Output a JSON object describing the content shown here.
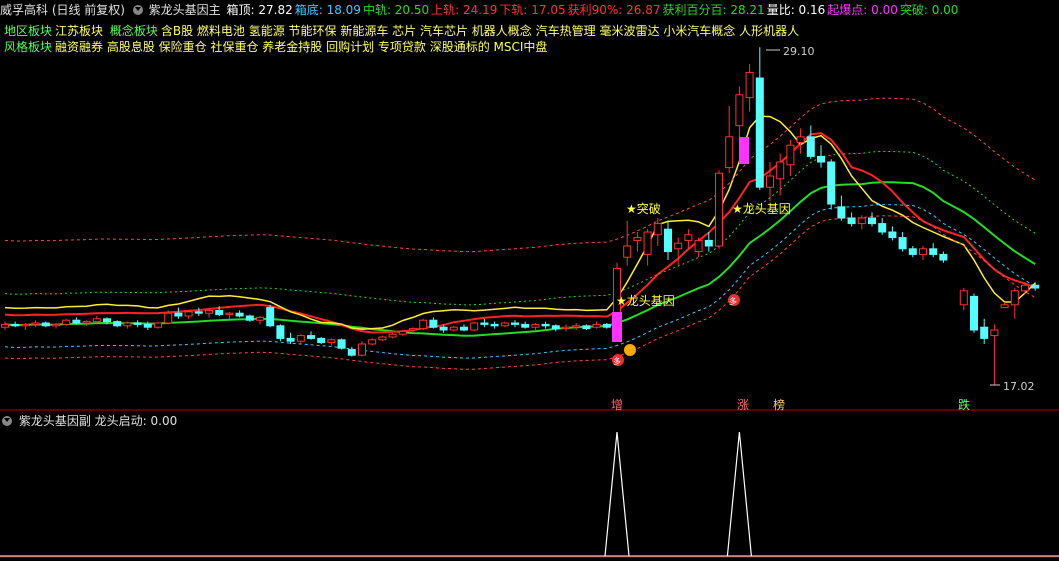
{
  "header": {
    "stock": "威孚高科 (日线 前复权)",
    "indicator": "紫龙头基因主",
    "items": [
      {
        "label": "箱顶:",
        "value": "27.82",
        "color": "#ffffff"
      },
      {
        "label": "箱底:",
        "value": "18.09",
        "color": "#3cc8ff"
      },
      {
        "label": "中轨:",
        "value": "20.50",
        "color": "#22dd22"
      },
      {
        "label": "上轨:",
        "value": "24.19",
        "color": "#ff3333"
      },
      {
        "label": "下轨:",
        "value": "17.05",
        "color": "#ff3333"
      },
      {
        "label": "获利90%:",
        "value": "26.87",
        "color": "#ff3333"
      },
      {
        "label": "获利百分百:",
        "value": "28.21",
        "color": "#22dd22"
      },
      {
        "label": "量比:",
        "value": "0.16",
        "color": "#ffffff"
      },
      {
        "label": "起爆点:",
        "value": "0.00",
        "color": "#ff33ff"
      },
      {
        "label": "突破:",
        "value": "0.00",
        "color": "#22dd22"
      }
    ]
  },
  "tags": {
    "region_label": "地区板块",
    "region": "江苏板块",
    "concept_label": "概念板块",
    "concepts": "含B股 燃料电池 氢能源 节能环保 新能源车 芯片 汽车芯片 机器人概念 汽车热管理 毫米波雷达 小米汽车概念 人形机器人",
    "style_label": "风格板块",
    "styles": "融资融券 高股息股 保险重仓 社保重仓 养老金持股 回购计划 专项贷款 深股通标的 MSCI中盘"
  },
  "annotations": {
    "high_label": "29.10",
    "low_label": "17.02",
    "break1": "★突破",
    "dragon1": "★龙头基因",
    "dragon2": "★龙头基因",
    "marker_duo": "多",
    "bottom_labels": [
      "增",
      "涨",
      "榜",
      "跌"
    ]
  },
  "sub": {
    "title": "紫龙头基因副",
    "label": "龙头启动:",
    "value": "0.00"
  },
  "chart_data": {
    "type": "candlestick",
    "price_range": [
      16.5,
      30.0
    ],
    "high": 29.1,
    "low": 17.02,
    "candles": [
      [
        19.1,
        19.3,
        19.0,
        19.2
      ],
      [
        19.2,
        19.3,
        19.1,
        19.15
      ],
      [
        19.15,
        19.25,
        19.0,
        19.2
      ],
      [
        19.2,
        19.35,
        19.1,
        19.25
      ],
      [
        19.25,
        19.3,
        19.1,
        19.15
      ],
      [
        19.15,
        19.25,
        19.05,
        19.2
      ],
      [
        19.2,
        19.4,
        19.15,
        19.35
      ],
      [
        19.35,
        19.45,
        19.2,
        19.25
      ],
      [
        19.25,
        19.35,
        19.15,
        19.3
      ],
      [
        19.3,
        19.5,
        19.25,
        19.4
      ],
      [
        19.4,
        19.45,
        19.2,
        19.3
      ],
      [
        19.3,
        19.35,
        19.1,
        19.15
      ],
      [
        19.15,
        19.3,
        19.05,
        19.25
      ],
      [
        19.25,
        19.35,
        19.1,
        19.2
      ],
      [
        19.2,
        19.3,
        19.0,
        19.1
      ],
      [
        19.1,
        19.3,
        19.05,
        19.25
      ],
      [
        19.25,
        19.7,
        19.2,
        19.6
      ],
      [
        19.6,
        19.8,
        19.4,
        19.5
      ],
      [
        19.5,
        19.7,
        19.4,
        19.65
      ],
      [
        19.65,
        19.8,
        19.5,
        19.6
      ],
      [
        19.6,
        19.75,
        19.45,
        19.7
      ],
      [
        19.7,
        19.85,
        19.5,
        19.55
      ],
      [
        19.55,
        19.65,
        19.4,
        19.6
      ],
      [
        19.6,
        19.7,
        19.45,
        19.5
      ],
      [
        19.5,
        19.55,
        19.3,
        19.35
      ],
      [
        19.35,
        19.5,
        19.2,
        19.45
      ],
      [
        19.8,
        19.9,
        19.1,
        19.15
      ],
      [
        19.15,
        19.2,
        18.6,
        18.7
      ],
      [
        18.7,
        18.9,
        18.5,
        18.6
      ],
      [
        18.6,
        18.85,
        18.5,
        18.8
      ],
      [
        18.8,
        18.95,
        18.65,
        18.7
      ],
      [
        18.7,
        18.75,
        18.5,
        18.55
      ],
      [
        18.55,
        18.7,
        18.45,
        18.65
      ],
      [
        18.65,
        18.7,
        18.3,
        18.35
      ],
      [
        18.3,
        18.4,
        18.05,
        18.1
      ],
      [
        18.1,
        18.6,
        18.05,
        18.5
      ],
      [
        18.5,
        18.7,
        18.45,
        18.65
      ],
      [
        18.65,
        18.8,
        18.6,
        18.75
      ],
      [
        18.75,
        18.9,
        18.7,
        18.85
      ],
      [
        18.85,
        19.0,
        18.8,
        18.95
      ],
      [
        19.0,
        19.1,
        18.9,
        19.05
      ],
      [
        19.05,
        19.4,
        19.0,
        19.35
      ],
      [
        19.35,
        19.45,
        19.05,
        19.1
      ],
      [
        19.1,
        19.2,
        18.9,
        19.0
      ],
      [
        19.0,
        19.15,
        18.95,
        19.1
      ],
      [
        19.1,
        19.2,
        18.95,
        19.0
      ],
      [
        19.0,
        19.3,
        18.95,
        19.25
      ],
      [
        19.25,
        19.4,
        19.1,
        19.2
      ],
      [
        19.2,
        19.3,
        19.05,
        19.15
      ],
      [
        19.15,
        19.3,
        19.1,
        19.25
      ],
      [
        19.25,
        19.35,
        19.1,
        19.2
      ],
      [
        19.2,
        19.3,
        19.05,
        19.1
      ],
      [
        19.1,
        19.25,
        19.0,
        19.2
      ],
      [
        19.2,
        19.3,
        19.05,
        19.15
      ],
      [
        19.15,
        19.2,
        18.95,
        19.05
      ],
      [
        19.05,
        19.2,
        18.95,
        19.1
      ],
      [
        19.1,
        19.25,
        19.0,
        19.15
      ],
      [
        19.15,
        19.2,
        19.0,
        19.05
      ],
      [
        19.1,
        19.3,
        19.05,
        19.2
      ],
      [
        19.2,
        19.25,
        19.05,
        19.1
      ],
      [
        19.3,
        21.4,
        19.2,
        21.2
      ],
      [
        21.6,
        22.9,
        21.3,
        22.0
      ],
      [
        22.2,
        22.5,
        21.8,
        22.3
      ],
      [
        21.7,
        22.6,
        21.3,
        22.5
      ],
      [
        22.4,
        23.0,
        22.0,
        22.8
      ],
      [
        22.6,
        22.9,
        21.5,
        21.8
      ],
      [
        21.9,
        22.3,
        21.3,
        22.1
      ],
      [
        22.2,
        22.6,
        21.9,
        22.4
      ],
      [
        21.8,
        22.3,
        21.6,
        22.2
      ],
      [
        22.2,
        22.5,
        21.8,
        22.0
      ],
      [
        22.0,
        24.7,
        21.9,
        24.6
      ],
      [
        24.8,
        27.0,
        24.6,
        25.9
      ],
      [
        26.3,
        27.7,
        25.8,
        27.4
      ],
      [
        27.3,
        28.5,
        26.8,
        28.2
      ],
      [
        28.0,
        29.1,
        24.0,
        24.1
      ],
      [
        24.1,
        25.0,
        23.6,
        24.5
      ],
      [
        24.4,
        25.3,
        23.8,
        25.0
      ],
      [
        24.9,
        25.8,
        24.5,
        25.6
      ],
      [
        25.7,
        26.2,
        25.3,
        25.9
      ],
      [
        25.9,
        26.3,
        25.1,
        25.2
      ],
      [
        25.2,
        25.6,
        24.8,
        25.0
      ],
      [
        25.0,
        25.1,
        23.3,
        23.5
      ],
      [
        23.4,
        23.8,
        22.9,
        23.0
      ],
      [
        23.0,
        23.2,
        22.7,
        22.8
      ],
      [
        22.8,
        23.1,
        22.6,
        23.0
      ],
      [
        23.0,
        23.2,
        22.7,
        22.8
      ],
      [
        22.8,
        23.0,
        22.4,
        22.5
      ],
      [
        22.5,
        22.7,
        22.2,
        22.3
      ],
      [
        22.3,
        22.5,
        21.8,
        21.9
      ],
      [
        21.9,
        22.0,
        21.6,
        21.7
      ],
      [
        21.7,
        22.0,
        21.5,
        21.9
      ],
      [
        21.9,
        22.1,
        21.6,
        21.7
      ],
      [
        21.7,
        21.8,
        21.4,
        21.5
      ],
      [
        null,
        null,
        null,
        null
      ],
      [
        19.9,
        20.5,
        19.7,
        20.4
      ],
      [
        20.2,
        20.3,
        18.9,
        19.0
      ],
      [
        19.1,
        19.4,
        18.5,
        18.7
      ],
      [
        18.8,
        19.2,
        17.02,
        19.0
      ],
      [
        19.8,
        20.0,
        19.8,
        19.9
      ],
      [
        19.9,
        20.5,
        19.4,
        20.4
      ],
      [
        20.4,
        20.7,
        20.3,
        20.6
      ],
      [
        20.6,
        20.7,
        20.4,
        20.5
      ]
    ],
    "sub_chart": {
      "type": "line",
      "spikes_at": [
        60,
        72
      ],
      "values_range": [
        0,
        1
      ]
    }
  }
}
